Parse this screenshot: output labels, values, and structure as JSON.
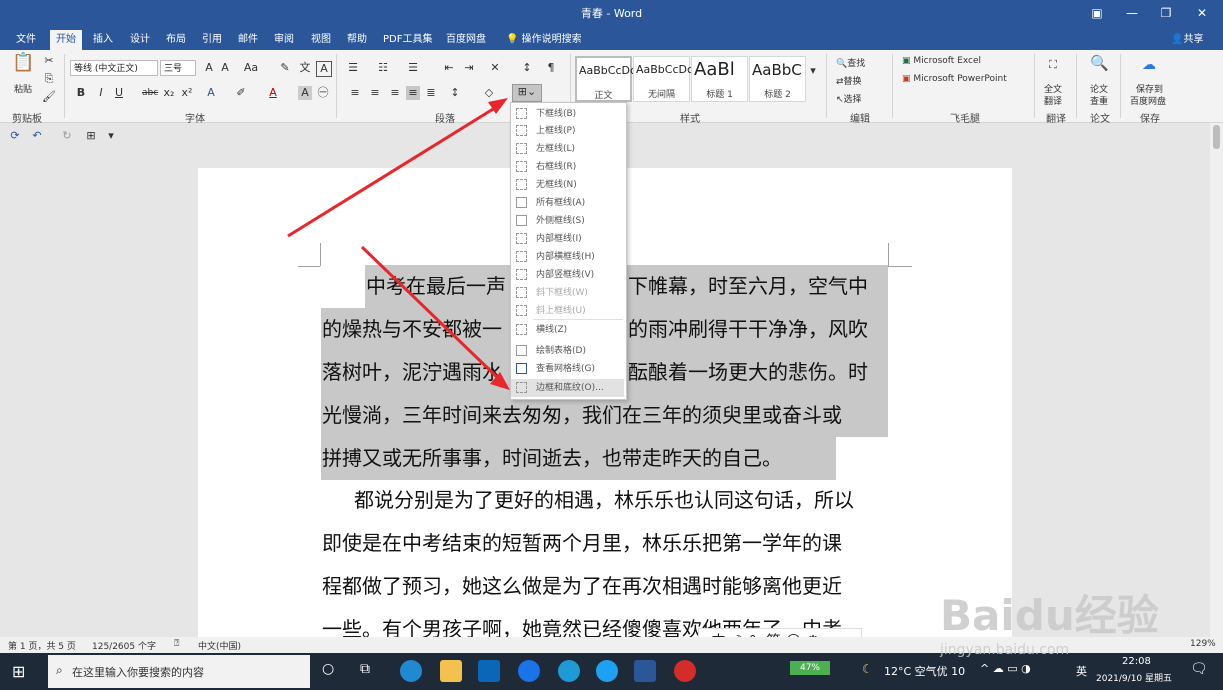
{
  "window": {
    "title": "青春 - Word"
  },
  "tabs": [
    "文件",
    "开始",
    "插入",
    "设计",
    "布局",
    "引用",
    "邮件",
    "审阅",
    "视图",
    "帮助",
    "PDF工具集",
    "百度网盘",
    "操作说明搜索"
  ],
  "share_label": "共享",
  "ribbon": {
    "clipboard": {
      "paste": "粘贴",
      "label": "剪贴板"
    },
    "font": {
      "name": "等线 (中文正文)",
      "size": "三号",
      "label": "字体"
    },
    "paragraph": {
      "label": "段落"
    },
    "styles": {
      "items": [
        {
          "sample": "AaBbCcDc",
          "name": "正文"
        },
        {
          "sample": "AaBbCcDc",
          "name": "无间隔"
        },
        {
          "sample": "AaBl",
          "name": "标题 1"
        },
        {
          "sample": "AaBbC",
          "name": "标题 2"
        }
      ],
      "label": "样式"
    },
    "editing": {
      "find": "查找",
      "replace": "替换",
      "select": "选择",
      "label": "编辑"
    },
    "feimao": {
      "excel": "Microsoft Excel",
      "ppt": "Microsoft PowerPoint",
      "label": "飞毛腿"
    },
    "translate": {
      "btn1": "全文",
      "btn2": "翻译",
      "label": "翻译"
    },
    "paper": {
      "btn1": "论文",
      "btn2": "查重",
      "label": "论文"
    },
    "save": {
      "btn1": "保存到",
      "btn2": "百度网盘",
      "label": "保存"
    }
  },
  "border_menu": {
    "items": [
      {
        "label": "下框线(B)",
        "dim": false
      },
      {
        "label": "上框线(P)",
        "dim": false
      },
      {
        "label": "左框线(L)",
        "dim": false
      },
      {
        "label": "右框线(R)",
        "dim": false
      },
      {
        "label": "无框线(N)",
        "dim": false
      },
      {
        "label": "所有框线(A)",
        "dim": false
      },
      {
        "label": "外侧框线(S)",
        "dim": false
      },
      {
        "label": "内部框线(I)",
        "dim": false
      },
      {
        "label": "内部横框线(H)",
        "dim": false
      },
      {
        "label": "内部竖框线(V)",
        "dim": false
      },
      {
        "label": "斜下框线(W)",
        "dim": true
      },
      {
        "label": "斜上框线(U)",
        "dim": true
      },
      {
        "label": "横线(Z)",
        "dim": false
      },
      {
        "label": "绘制表格(D)",
        "dim": false
      },
      {
        "label": "查看网格线(G)",
        "dim": false
      },
      {
        "label": "边框和底纹(O)...",
        "dim": false
      }
    ]
  },
  "document": {
    "lines": [
      "中考在最后一声",
      "下帷幕，时至六月，空气中",
      "的燥热与不安都被一",
      "的雨冲刷得干干净净，风吹",
      "落树叶，泥泞遇雨水",
      "酝酿着一场更大的悲伤。时",
      "光慢淌，三年时间来去匆匆，我们在三年的须臾里或奋斗或",
      "拼搏又或无所事事，时间逝去，也带走昨天的自己。",
      "都说分别是为了更好的相遇，林乐乐也认同这句话，所以",
      "即使是在中考结束的短暂两个月里，林乐乐把第一学年的课",
      "程都做了预习，她这么做是为了在再次相遇时能够离他更近",
      "一些。有个男孩子啊，她竟然已经傻傻喜欢他两年了。中考"
    ]
  },
  "status": {
    "page": "第 1 页，共 5 页",
    "words": "125/2605 个字",
    "lang": "中文(中国)",
    "zoom": "129%"
  },
  "ime": {
    "text": "中 ☽ °, 简 ☺ ⚙"
  },
  "taskbar": {
    "search_placeholder": "在这里输入你要搜索的内容",
    "weather": "12°C  空气优 10",
    "lang": "英",
    "time": "22:08",
    "date": "2021/9/10 星期五",
    "battery": "47%"
  },
  "watermark": {
    "brand": "Baidu经验",
    "url": "jingyan.baidu.com"
  }
}
